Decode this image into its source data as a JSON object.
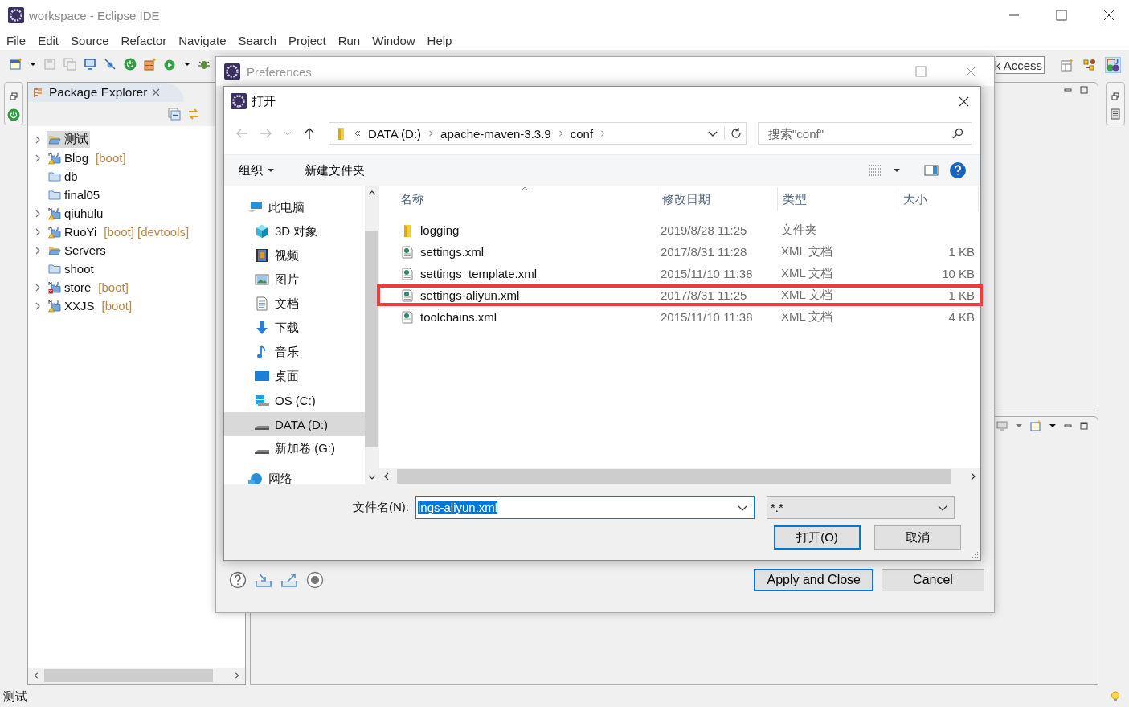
{
  "window": {
    "title": "workspace - Eclipse IDE"
  },
  "menu": [
    "File",
    "Edit",
    "Source",
    "Refactor",
    "Navigate",
    "Search",
    "Project",
    "Run",
    "Window",
    "Help"
  ],
  "quick_access": {
    "value": "k Access"
  },
  "package_explorer": {
    "title": "Package Explorer",
    "items": [
      {
        "name": "测试",
        "kind": "open-folder",
        "expandable": true,
        "selected": true
      },
      {
        "name": "Blog",
        "tags": "[boot]",
        "kind": "maven",
        "expandable": true,
        "selected": false
      },
      {
        "name": "db",
        "kind": "folder",
        "expandable": false,
        "selected": false
      },
      {
        "name": "final05",
        "kind": "folder",
        "expandable": false,
        "selected": false
      },
      {
        "name": "qiuhulu",
        "kind": "maven",
        "expandable": true,
        "selected": false
      },
      {
        "name": "RuoYi",
        "tags": "[boot] [devtools]",
        "kind": "maven",
        "expandable": true,
        "selected": false
      },
      {
        "name": "Servers",
        "kind": "open-folder",
        "expandable": true,
        "selected": false
      },
      {
        "name": "shoot",
        "kind": "folder",
        "expandable": false,
        "selected": false
      },
      {
        "name": "store",
        "tags": "[boot]",
        "kind": "maven-error",
        "expandable": true,
        "selected": false
      },
      {
        "name": "XXJS",
        "tags": "[boot]",
        "kind": "maven",
        "expandable": true,
        "selected": false
      }
    ]
  },
  "preferences": {
    "title": "Preferences",
    "buttons": [
      {
        "label": "Apply and Close",
        "default": true
      },
      {
        "label": "Cancel",
        "default": false
      }
    ]
  },
  "open_dialog": {
    "title": "打开",
    "path": [
      "DATA (D:)",
      "apache-maven-3.3.9",
      "conf"
    ],
    "search": {
      "placeholder": "搜索\"conf\""
    },
    "toolbar": [
      "组织",
      "新建文件夹"
    ],
    "nav": [
      {
        "label": "此电脑",
        "kind": "pc",
        "selected": false
      },
      {
        "label": "3D 对象",
        "kind": "cube",
        "selected": false
      },
      {
        "label": "视频",
        "kind": "video",
        "selected": false
      },
      {
        "label": "图片",
        "kind": "pictures",
        "selected": false
      },
      {
        "label": "文档",
        "kind": "documents",
        "selected": false
      },
      {
        "label": "下载",
        "kind": "downloads",
        "selected": false
      },
      {
        "label": "音乐",
        "kind": "music",
        "selected": false
      },
      {
        "label": "桌面",
        "kind": "desktop",
        "selected": false
      },
      {
        "label": "OS (C:)",
        "kind": "system-drive",
        "selected": false
      },
      {
        "label": "DATA (D:)",
        "kind": "drive",
        "selected": true
      },
      {
        "label": "新加卷 (G:)",
        "kind": "drive",
        "selected": false
      },
      {
        "label": "网络",
        "kind": "network",
        "selected": false
      }
    ],
    "columns": [
      "名称",
      "修改日期",
      "类型",
      "大小"
    ],
    "files": [
      {
        "name": "logging",
        "date": "2019/8/28 11:25",
        "type": "文件夹",
        "kind": "folder",
        "marked": false
      },
      {
        "name": "settings.xml",
        "date": "2017/8/31 11:28",
        "type": "XML 文档",
        "size": "1 KB",
        "kind": "xml",
        "marked": false
      },
      {
        "name": "settings_template.xml",
        "date": "2015/11/10 11:38",
        "type": "XML 文档",
        "size": "10 KB",
        "kind": "xml",
        "marked": false
      },
      {
        "name": "settings-aliyun.xml",
        "date": "2017/8/31 11:25",
        "type": "XML 文档",
        "size": "1 KB",
        "kind": "xml",
        "marked": true
      },
      {
        "name": "toolchains.xml",
        "date": "2015/11/10 11:38",
        "type": "XML 文档",
        "size": "4 KB",
        "kind": "xml",
        "marked": false
      }
    ],
    "filename": {
      "label": "文件名(N):",
      "value": "ings-aliyun.xml"
    },
    "filter": {
      "value": "*.*"
    },
    "buttons": [
      {
        "label": "打开(O)",
        "default": true
      },
      {
        "label": "取消",
        "default": false
      }
    ]
  },
  "status_bar": {
    "text": "测试"
  }
}
